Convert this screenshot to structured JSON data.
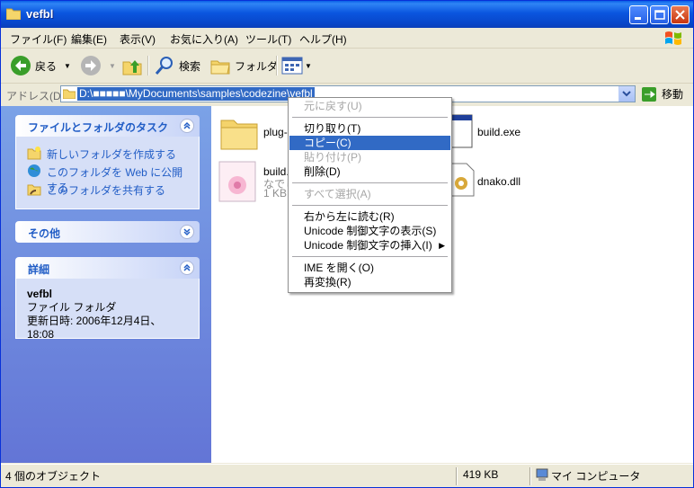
{
  "window": {
    "title": "vefbl"
  },
  "menubar": {
    "items": [
      "ファイル(F)",
      "編集(E)",
      "表示(V)",
      "お気に入り(A)",
      "ツール(T)",
      "ヘルプ(H)"
    ]
  },
  "toolbar": {
    "back_label": "戻る",
    "search_label": "検索",
    "folders_label": "フォルダ"
  },
  "address": {
    "label": "アドレス(D)",
    "value": "D:\\■■■■■\\MyDocuments\\samples\\codezine\\vefbl",
    "go_label": "移動"
  },
  "tasks": {
    "folder_tasks_title": "ファイルとフォルダのタスク",
    "items": [
      "新しいフォルダを作成する",
      "このフォルダを Web に公開する",
      "このフォルダを共有する"
    ],
    "other_title": "その他",
    "details_title": "詳細",
    "detail_name": "vefbl",
    "detail_type": "ファイル フォルダ",
    "detail_date": "更新日時: 2006年12月4日、18:08"
  },
  "files": [
    {
      "name": "plug-",
      "icon": "folder-icon"
    },
    {
      "name": "build.exe",
      "icon": "exe-icon"
    },
    {
      "name": "build.",
      "sub1": "なでし",
      "sub2": "1 KB",
      "icon": "image-file-icon"
    },
    {
      "name": "dnako.dll",
      "icon": "dll-icon"
    }
  ],
  "context_menu": {
    "items": [
      {
        "label": "元に戻す(U)",
        "state": "disabled"
      },
      {
        "label": "切り取り(T)",
        "state": "normal"
      },
      {
        "label": "コピー(C)",
        "state": "selected"
      },
      {
        "label": "貼り付け(P)",
        "state": "disabled"
      },
      {
        "label": "削除(D)",
        "state": "normal"
      },
      {
        "label": "すべて選択(A)",
        "state": "disabled"
      },
      {
        "label": "右から左に読む(R)",
        "state": "normal"
      },
      {
        "label": "Unicode 制御文字の表示(S)",
        "state": "normal"
      },
      {
        "label": "Unicode 制御文字の挿入(I)",
        "state": "normal"
      },
      {
        "label": "IME を開く(O)",
        "state": "normal"
      },
      {
        "label": "再変換(R)",
        "state": "normal"
      }
    ]
  },
  "statusbar": {
    "objects": "4 個のオブジェクト",
    "size": "419 KB",
    "location": "マイ コンピュータ"
  },
  "colors": {
    "title_blue": "#0a55df",
    "task_pane": "#6f8ee0",
    "selection": "#316ac5"
  }
}
